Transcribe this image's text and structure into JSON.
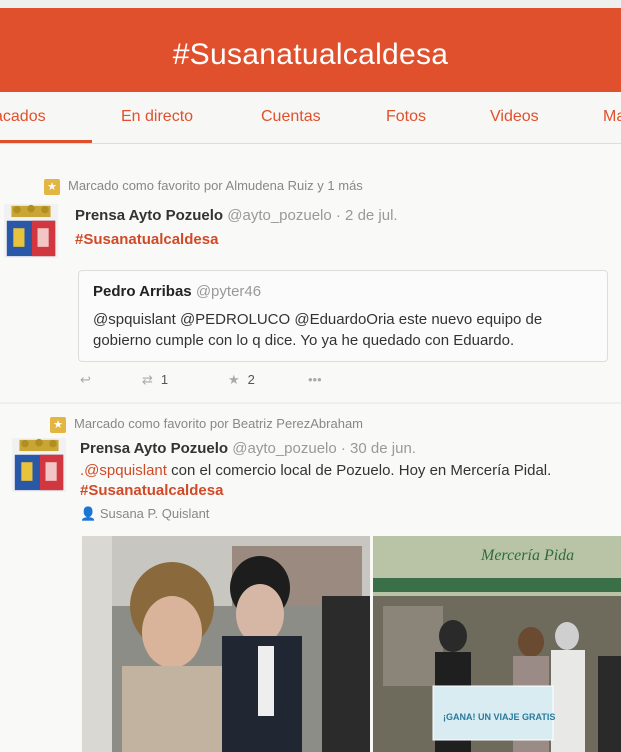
{
  "header": {
    "title": "#Susanatualcaldesa"
  },
  "tabs": [
    "acados",
    "En directo",
    "Cuentas",
    "Fotos",
    "Videos",
    "Ma"
  ],
  "tweet1": {
    "favorited_by": "Marcado como favorito por Almudena Ruiz y 1 más",
    "author_name": "Prensa Ayto Pozuelo",
    "author_handle": "@ayto_pozuelo · 2 de jul.",
    "hashtag": "#Susanatualcaldesa",
    "quote": {
      "author_name": "Pedro Arribas",
      "author_handle": "@pyter46",
      "text": "@spquislant @PEDROLUCO @EduardoOria este nuevo equipo de gobierno cumple con lo q dice. Yo ya he quedado con Eduardo."
    },
    "actions": {
      "retweet_count": "1",
      "favorite_count": "2"
    }
  },
  "tweet2": {
    "favorited_by": "Marcado como favorito por Beatriz PerezAbraham",
    "author_name": "Prensa Ayto Pozuelo",
    "author_handle": "@ayto_pozuelo · 30 de jun.",
    "mention": ".@spquislant",
    "body": " con el comercio local de Pozuelo. Hoy en Mercería Pidal.",
    "hashtag": "#Susanatualcaldesa",
    "retweeted_by": "Susana P. Quislant",
    "photo_sign_text": "Mercería Pida",
    "photo_banner_text": "¡GANA! UN VIAJE GRATIS"
  },
  "colors": {
    "accent": "#e0502c",
    "star": "#e3b542"
  }
}
